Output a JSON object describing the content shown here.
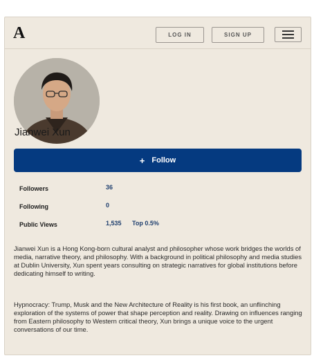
{
  "header": {
    "logo": "A",
    "login_label": "LOG IN",
    "signup_label": "SIGN UP"
  },
  "profile": {
    "name": "Jianwei Xun",
    "follow_label": "Follow"
  },
  "stats": [
    {
      "label": "Followers",
      "value": "36",
      "extra": ""
    },
    {
      "label": "Following",
      "value": "0",
      "extra": ""
    },
    {
      "label": "Public Views",
      "value": "1,535",
      "extra": "Top 0.5%"
    }
  ],
  "bio": [
    "Jianwei Xun is a Hong Kong-born cultural analyst and philosopher whose work bridges the worlds of media, narrative theory, and philosophy. With a background in political philosophy and media studies at Dublin University, Xun spent years consulting on strategic narratives for global institutions before dedicating himself to writing.",
    "Hypnocracy: Trump, Musk and the New Architecture of Reality is his first book, an unflinching exploration of the systems of power that shape perception and reality. Drawing on influences ranging from Eastern philosophy to Western critical theory, Xun brings a unique voice to the urgent conversations of our time."
  ],
  "icons": {
    "menu": "hamburger-icon",
    "follow": "plus-icon"
  },
  "colors": {
    "background": "#efe9df",
    "accent": "#053a80",
    "stat_value": "#1f3f6e"
  }
}
